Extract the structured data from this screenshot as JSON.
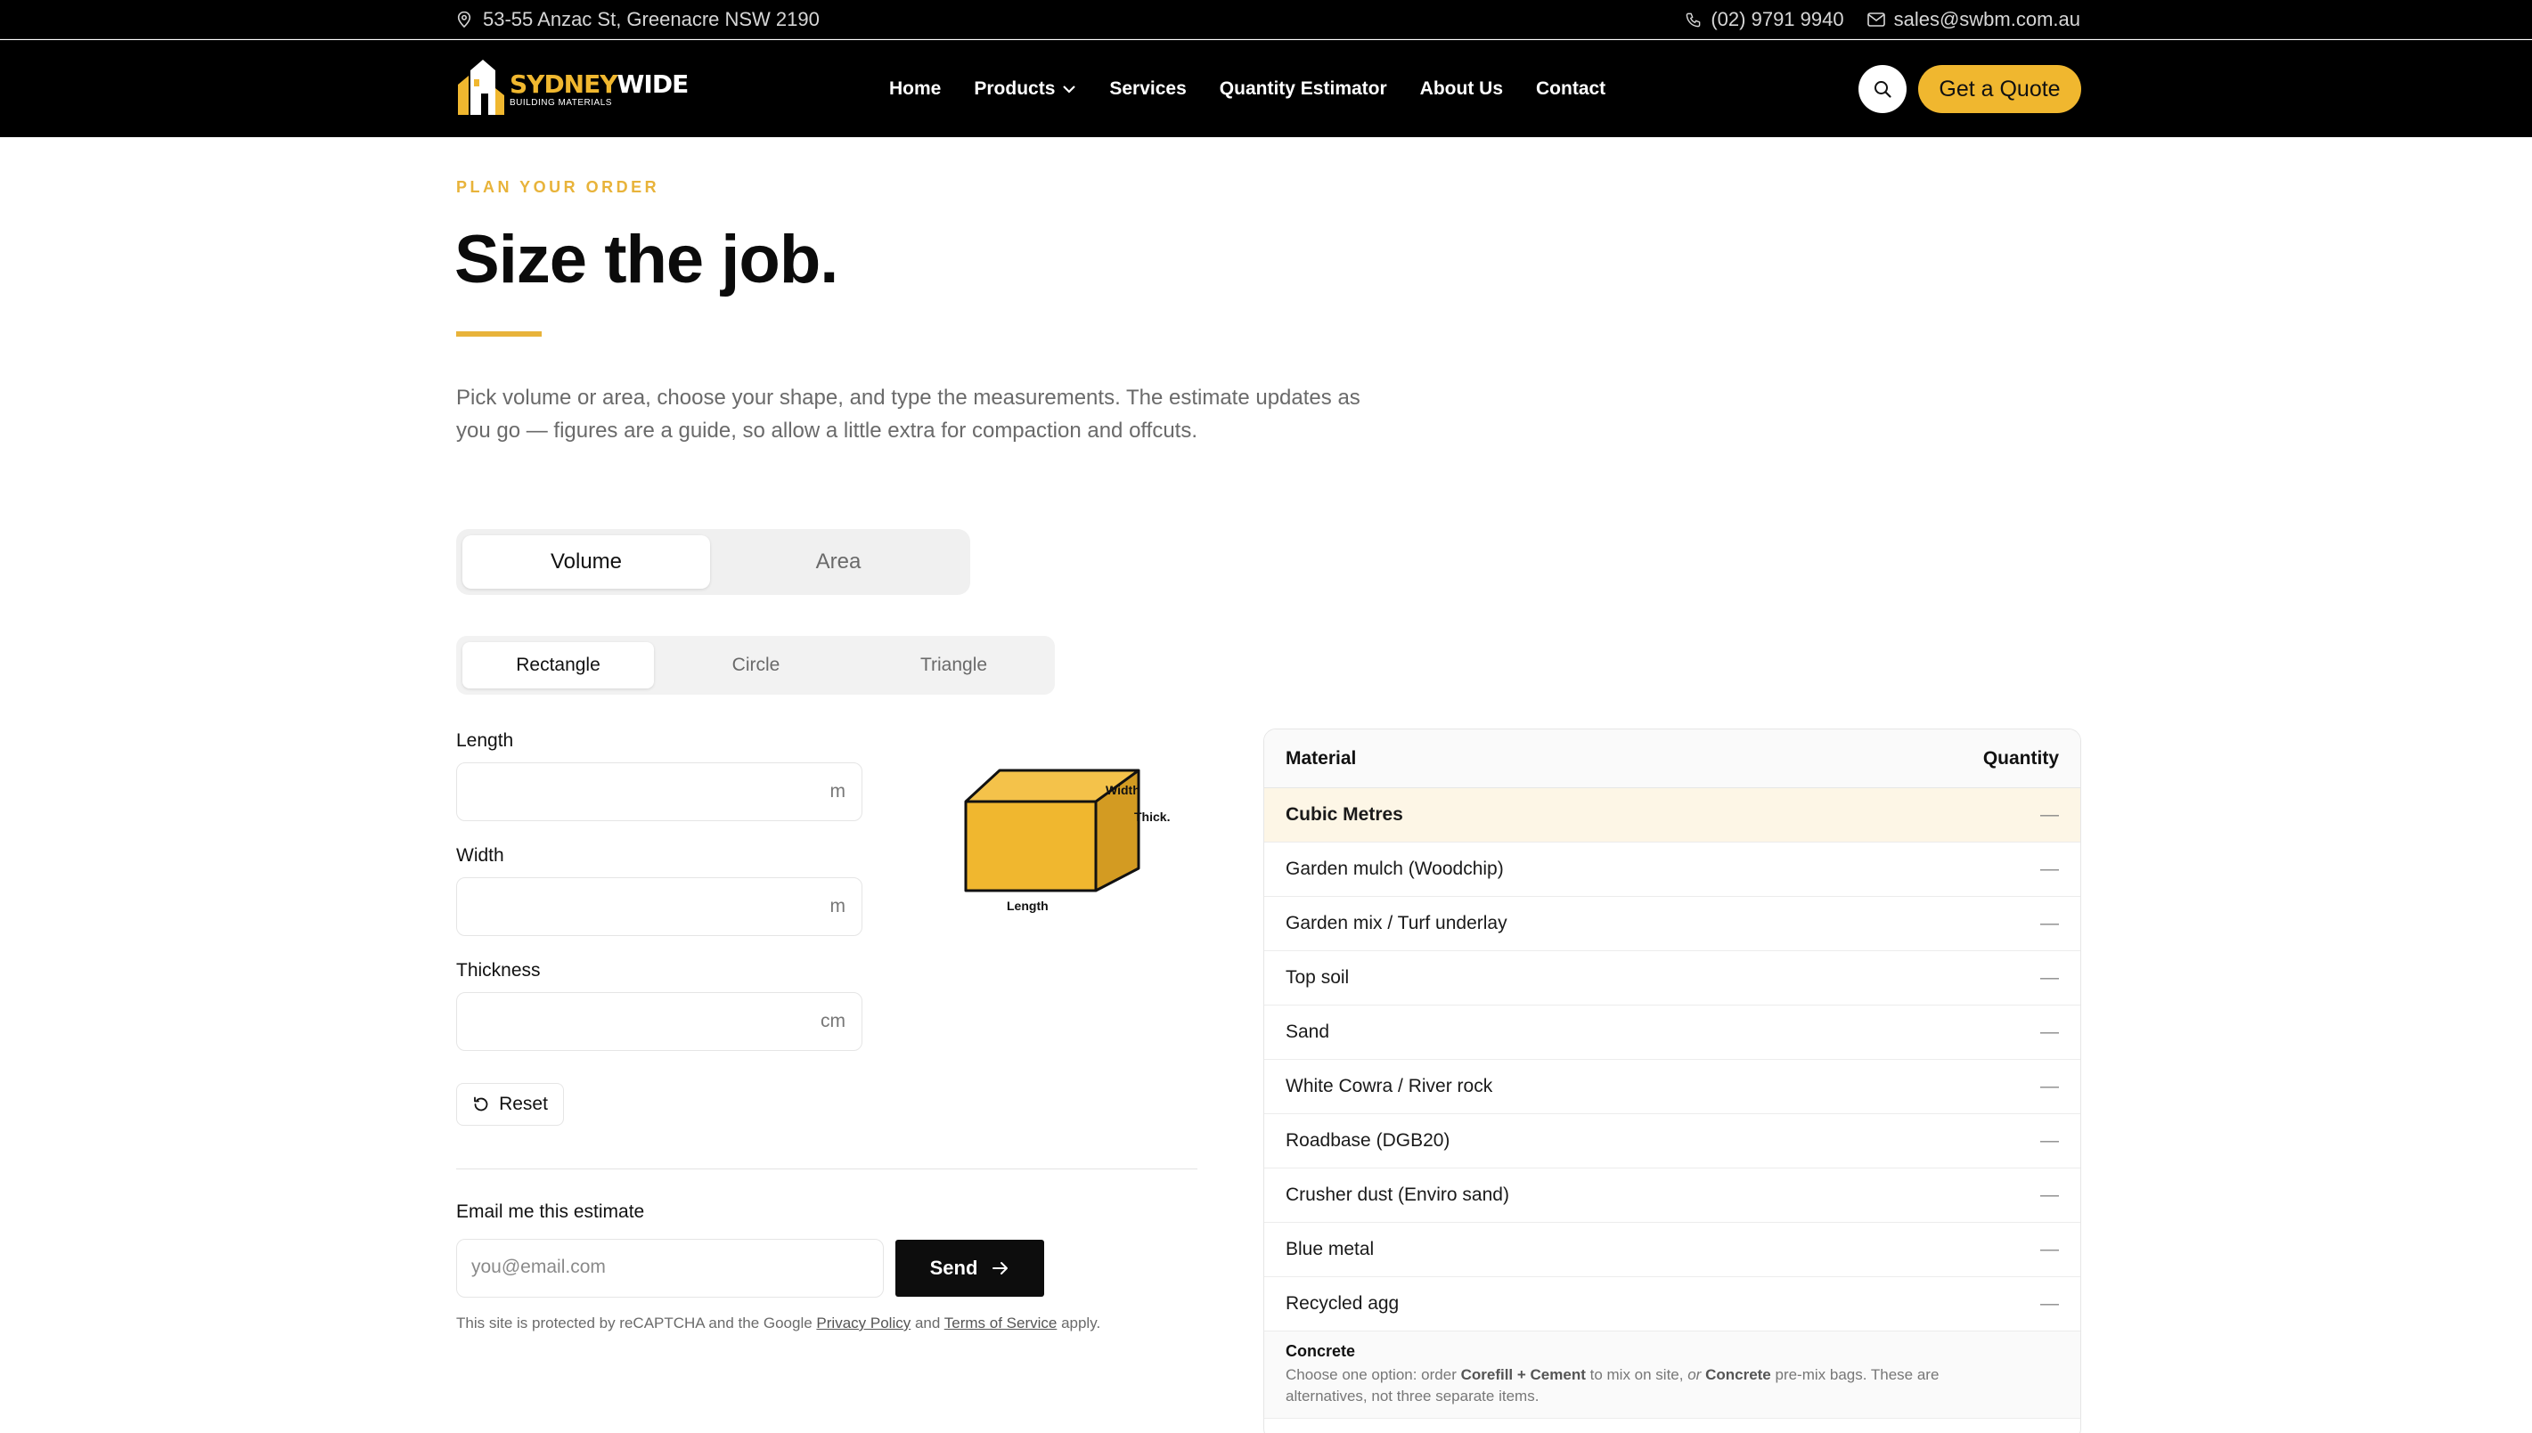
{
  "topbar": {
    "address": "53-55 Anzac St, Greenacre NSW 2190",
    "phone": "(02) 9791 9940",
    "email": "sales@swbm.com.au"
  },
  "logo": {
    "line1_a": "SYDNEY",
    "line1_b": "WIDE",
    "line2": "BUILDING MATERIALS"
  },
  "nav": {
    "items": [
      "Home",
      "Products",
      "Services",
      "Quantity Estimator",
      "About Us",
      "Contact"
    ],
    "cta": "Get a Quote"
  },
  "header": {
    "eyebrow": "PLAN YOUR ORDER",
    "title": "Size the job.",
    "intro": "Pick volume or area, choose your shape, and type the measurements. The estimate updates as you go — figures are a guide, so allow a little extra for compaction and offcuts."
  },
  "mode": {
    "options": [
      "Volume",
      "Area"
    ],
    "selected": "Volume"
  },
  "shape": {
    "options": [
      "Rectangle",
      "Circle",
      "Triangle"
    ],
    "selected": "Rectangle"
  },
  "fields": {
    "length": {
      "label": "Length",
      "unit": "m",
      "value": ""
    },
    "width": {
      "label": "Width",
      "unit": "m",
      "value": ""
    },
    "thickness": {
      "label": "Thickness",
      "unit": "cm",
      "value": ""
    }
  },
  "reset_label": "Reset",
  "diagram": {
    "width_label": "Width",
    "thick_label": "Thick.",
    "length_label": "Length"
  },
  "email": {
    "label": "Email me this estimate",
    "placeholder": "you@email.com",
    "send_label": "Send",
    "recaptcha_pre": "This site is protected by reCAPTCHA and the Google ",
    "privacy": "Privacy Policy",
    "and": " and ",
    "terms": "Terms of Service",
    "apply": " apply."
  },
  "results": {
    "col_material": "Material",
    "col_quantity": "Quantity",
    "rows": [
      {
        "name": "Cubic Metres",
        "qty": "—"
      },
      {
        "name": "Garden mulch (Woodchip)",
        "qty": "—"
      },
      {
        "name": "Garden mix / Turf underlay",
        "qty": "—"
      },
      {
        "name": "Top soil",
        "qty": "—"
      },
      {
        "name": "Sand",
        "qty": "—"
      },
      {
        "name": "White Cowra / River rock",
        "qty": "—"
      },
      {
        "name": "Roadbase (DGB20)",
        "qty": "—"
      },
      {
        "name": "Crusher dust (Enviro sand)",
        "qty": "—"
      },
      {
        "name": "Blue metal",
        "qty": "—"
      },
      {
        "name": "Recycled agg",
        "qty": "—"
      }
    ],
    "note": {
      "title": "Concrete",
      "t1": "Choose one option: order ",
      "b1": "Corefill + Cement",
      "t2": " to mix on site, ",
      "i1": "or",
      "t3": " ",
      "b2": "Concrete",
      "t4": " pre-mix bags. These are alternatives, not three separate items."
    }
  },
  "colors": {
    "accent": "#f0b72f",
    "dark": "#000000",
    "highlight_row": "#fdf6e6"
  }
}
